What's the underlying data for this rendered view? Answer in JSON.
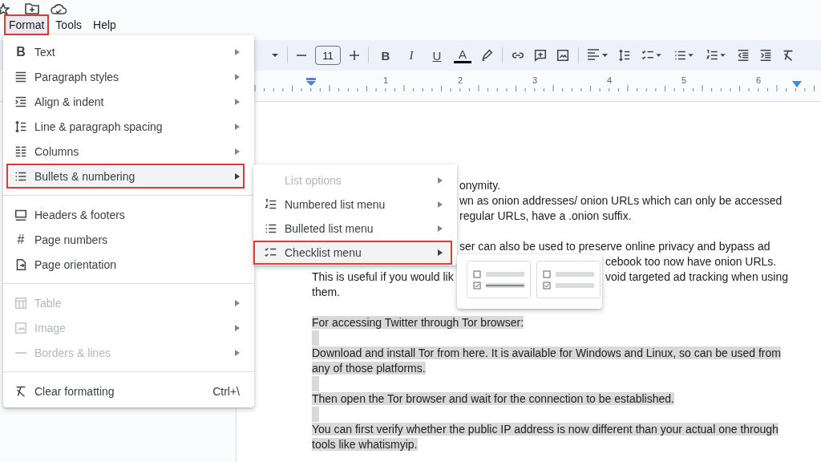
{
  "menu_bar": [
    {
      "label": "Format",
      "selected": true
    },
    {
      "label": "Tools",
      "selected": false
    },
    {
      "label": "Help",
      "selected": false
    }
  ],
  "toolbar": {
    "font_size": "11",
    "glyphs": [
      "B",
      "I",
      "U",
      "A"
    ]
  },
  "ruler": {
    "labels": [
      "1",
      "2",
      "3",
      "4",
      "5",
      "6"
    ]
  },
  "format_menu": {
    "groups": [
      {
        "items": [
          {
            "glyph": "B",
            "label": "Text",
            "submenu": true,
            "disabled": false,
            "selected": false
          },
          {
            "label": "Paragraph styles",
            "submenu": true,
            "disabled": false,
            "selected": false
          },
          {
            "label": "Align & indent",
            "submenu": true,
            "disabled": false,
            "selected": false
          },
          {
            "label": "Line & paragraph spacing",
            "submenu": true,
            "disabled": false,
            "selected": false
          },
          {
            "label": "Columns",
            "submenu": true,
            "disabled": false,
            "selected": false
          },
          {
            "label": "Bullets & numbering",
            "submenu": true,
            "disabled": false,
            "selected": true
          }
        ]
      },
      {
        "items": [
          {
            "label": "Headers & footers",
            "submenu": false,
            "disabled": false,
            "selected": false
          },
          {
            "glyph": "#",
            "label": "Page numbers",
            "submenu": false,
            "disabled": false,
            "selected": false
          },
          {
            "label": "Page orientation",
            "submenu": false,
            "disabled": false,
            "selected": false
          }
        ]
      },
      {
        "items": [
          {
            "label": "Table",
            "submenu": true,
            "disabled": true,
            "selected": false
          },
          {
            "label": "Image",
            "submenu": true,
            "disabled": true,
            "selected": false
          },
          {
            "label": "Borders & lines",
            "submenu": true,
            "disabled": true,
            "selected": false
          }
        ]
      },
      {
        "items": [
          {
            "label": "Clear formatting",
            "shortcut": "Ctrl+\\",
            "submenu": false,
            "disabled": false,
            "selected": false
          }
        ]
      }
    ]
  },
  "submenu": {
    "items": [
      {
        "label": "List options",
        "disabled": true,
        "selected": false
      },
      {
        "label": "Numbered list menu",
        "disabled": false,
        "selected": false
      },
      {
        "label": "Bulleted list menu",
        "disabled": false,
        "selected": false
      },
      {
        "label": "Checklist menu",
        "disabled": false,
        "selected": true
      }
    ]
  },
  "document": {
    "lines": [
      {
        "selected": false,
        "parts": [
          "onymity."
        ]
      },
      {
        "selected": false,
        "parts": [
          "wn as onion addresses/ onion URLs which can only be accessed"
        ]
      },
      {
        "selected": false,
        "parts": [
          "regular URLs, have a .onion suffix."
        ]
      },
      {
        "selected": false
      },
      {
        "selected": false,
        "parts": [
          "ser can also be used to preserve online privacy and bypass ad"
        ]
      },
      {
        "selected": false,
        "parts": [
          "cebook too now have onion URLs."
        ]
      },
      {
        "selected": false,
        "parts": [
          "This is useful if you would lik",
          "void targeted ad tracking when using"
        ]
      },
      {
        "selected": false,
        "parts": [
          "them."
        ]
      },
      {
        "selected": false
      },
      {
        "selected": true,
        "parts": [
          "For accessing Twitter through Tor browser: "
        ]
      },
      {
        "selected": true
      },
      {
        "selected": true,
        "parts": [
          "Download and install Tor from here. It is available for Windows and Linux, so can be used from"
        ]
      },
      {
        "selected": true,
        "parts": [
          "any of those platforms. "
        ]
      },
      {
        "selected": true
      },
      {
        "selected": true,
        "parts": [
          "Then open the Tor browser and wait for the connection to be established. "
        ]
      },
      {
        "selected": true
      },
      {
        "selected": true,
        "parts": [
          "You can first verify whether the public IP address is now different than your actual one through"
        ]
      },
      {
        "selected": true,
        "parts": [
          "tools like whatismyip. "
        ]
      }
    ]
  }
}
